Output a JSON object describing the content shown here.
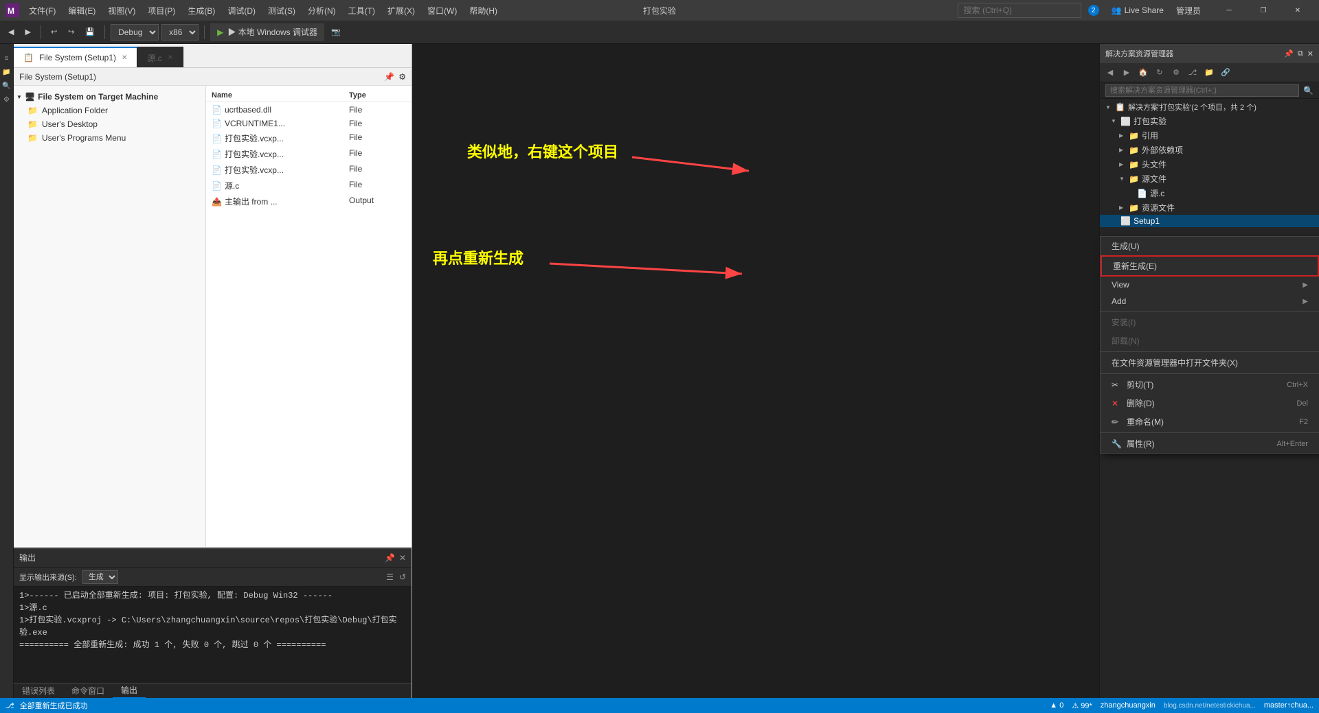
{
  "titlebar": {
    "logo": "VS",
    "menus": [
      "文件(F)",
      "编辑(E)",
      "视图(V)",
      "项目(P)",
      "生成(B)",
      "调试(D)",
      "测试(S)",
      "分析(N)",
      "工具(T)",
      "扩展(X)",
      "窗口(W)",
      "帮助(H)"
    ],
    "search_placeholder": "搜索 (Ctrl+Q)",
    "center_title": "打包实验",
    "live_share": "Live Share",
    "manage_label": "管理员",
    "notification_count": "2",
    "window_controls": [
      "─",
      "❐",
      "✕"
    ]
  },
  "toolbar": {
    "back_btn": "◀",
    "forward_btn": "▶",
    "undo_btn": "↩",
    "redo_btn": "↪",
    "config_label": "Debug",
    "platform_label": "x86",
    "run_label": "▶ 本地 Windows 调试器",
    "run_icon": "▶",
    "camera_icon": "📷"
  },
  "tabs": [
    {
      "label": "File System (Setup1)",
      "active": true,
      "closable": true
    },
    {
      "label": "源.c",
      "active": false,
      "closable": true
    }
  ],
  "fs_panel": {
    "header": "File System (Setup1)",
    "tree": {
      "root": "File System on Target Machine",
      "items": [
        {
          "label": "Application Folder",
          "level": 1,
          "type": "folder"
        },
        {
          "label": "User's Desktop",
          "level": 1,
          "type": "folder"
        },
        {
          "label": "User's Programs Menu",
          "level": 1,
          "type": "folder"
        }
      ]
    },
    "file_list": {
      "headers": [
        "Name",
        "Type"
      ],
      "files": [
        {
          "name": "ucrtbased.dll",
          "type": "File"
        },
        {
          "name": "VCRUNTIME1...",
          "type": "File"
        },
        {
          "name": "打包实验.vcxp...",
          "type": "File"
        },
        {
          "name": "打包实验.vcxp...",
          "type": "File"
        },
        {
          "name": "打包实验.vcxp...",
          "type": "File"
        },
        {
          "name": "源.c",
          "type": "File"
        },
        {
          "name": "主输出 from ...",
          "type": "Output"
        }
      ]
    }
  },
  "solution_explorer": {
    "title": "解决方案资源管理器",
    "search_placeholder": "搜索解决方案资源管理器(Ctrl+;)",
    "solution_label": "解决方案'打包实验'(2 个项目，共 2 个)",
    "tree": [
      {
        "label": "解决方案'打包实验'(2 个项目，共 2 个)",
        "level": 0,
        "type": "solution",
        "expanded": true
      },
      {
        "label": "打包实验",
        "level": 1,
        "type": "project",
        "expanded": true
      },
      {
        "label": "引用",
        "level": 2,
        "type": "folder"
      },
      {
        "label": "外部依赖项",
        "level": 2,
        "type": "folder"
      },
      {
        "label": "头文件",
        "level": 2,
        "type": "folder"
      },
      {
        "label": "源文件",
        "level": 2,
        "type": "folder",
        "expanded": true
      },
      {
        "label": "源.c",
        "level": 3,
        "type": "file"
      },
      {
        "label": "资源文件",
        "level": 2,
        "type": "folder"
      },
      {
        "label": "Setup1",
        "level": 1,
        "type": "project_selected",
        "selected": true
      }
    ]
  },
  "context_menu": {
    "items": [
      {
        "label": "生成(U)",
        "shortcut": "",
        "disabled": false,
        "highlighted": false
      },
      {
        "label": "重新生成(E)",
        "shortcut": "",
        "disabled": false,
        "highlighted": true
      },
      {
        "label": "View",
        "shortcut": "▶",
        "disabled": false,
        "has_submenu": true
      },
      {
        "label": "Add",
        "shortcut": "▶",
        "disabled": false,
        "has_submenu": true
      },
      {
        "label": "安装(I)",
        "shortcut": "",
        "disabled": true
      },
      {
        "label": "卸载(N)",
        "shortcut": "",
        "disabled": true
      },
      {
        "separator": true
      },
      {
        "label": "在文件资源管理器中打开文件夹(X)",
        "shortcut": "",
        "disabled": false
      },
      {
        "separator": true
      },
      {
        "label": "剪切(T)",
        "shortcut": "Ctrl+X",
        "disabled": false,
        "icon": "✂"
      },
      {
        "label": "删除(D)",
        "shortcut": "Del",
        "disabled": false,
        "icon": "✕"
      },
      {
        "label": "重命名(M)",
        "shortcut": "F2",
        "disabled": false,
        "icon": "📝"
      },
      {
        "separator": true
      },
      {
        "label": "属性(R)",
        "shortcut": "Alt+Enter",
        "disabled": false,
        "icon": "🔧"
      }
    ]
  },
  "annotations": {
    "text1": "类似地，右键这个项目",
    "text2": "再点重新生成"
  },
  "output_panel": {
    "title": "输出",
    "source_label": "显示输出来源(S):",
    "source_value": "生成",
    "content": [
      "1>------ 已启动全部重新生成: 项目: 打包实验, 配置: Debug Win32 ------",
      "1>源.c",
      "1>打包实验.vcxproj -> C:\\Users\\zhangchuangxin\\source\\repos\\打包实验\\Debug\\打包实验.exe",
      "========== 全部重新生成: 成功 1 个, 失败 0 个, 跳过 0 个 =========="
    ]
  },
  "bottom_tabs": [
    {
      "label": "错误列表",
      "active": false
    },
    {
      "label": "命令窗口",
      "active": false
    },
    {
      "label": "输出",
      "active": true
    }
  ],
  "status_bar": {
    "ready_text": "全部重新生成已成功",
    "errors": "▲ 0",
    "warnings": "⚠ 99*",
    "git_branch": "zhangchuangxin",
    "git_icon": "⎇",
    "remote": "master↑chua...",
    "encoding": "",
    "line_col": ""
  }
}
